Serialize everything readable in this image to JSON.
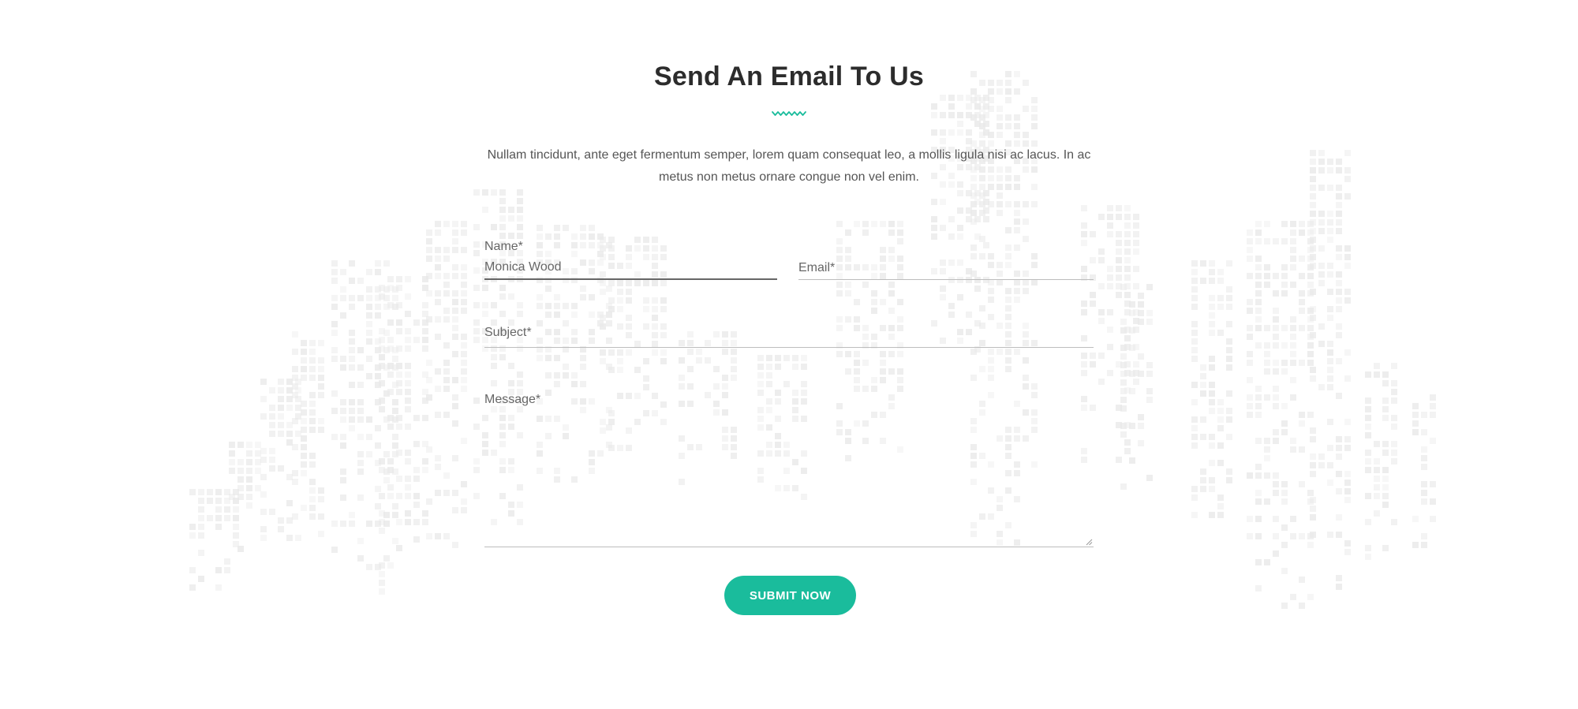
{
  "section": {
    "title": "Send An Email To Us",
    "intro": "Nullam tincidunt, ante eget fermentum semper, lorem quam consequat leo, a mollis ligula nisi ac lacus. In ac metus non metus ornare congue non vel enim."
  },
  "form": {
    "name": {
      "label": "Name*",
      "value": "Monica Wood"
    },
    "email": {
      "label": "Email*"
    },
    "subject": {
      "label": "Subject*"
    },
    "message": {
      "label": "Message*"
    },
    "submit_label": "SUBMIT NOW"
  },
  "colors": {
    "accent": "#1abc9c",
    "title": "#2c2c2c",
    "text": "#555555",
    "pattern": "#e8e8e8"
  },
  "icons": {
    "divider": "wave-divider-icon",
    "resize": "resize-grip-icon"
  }
}
